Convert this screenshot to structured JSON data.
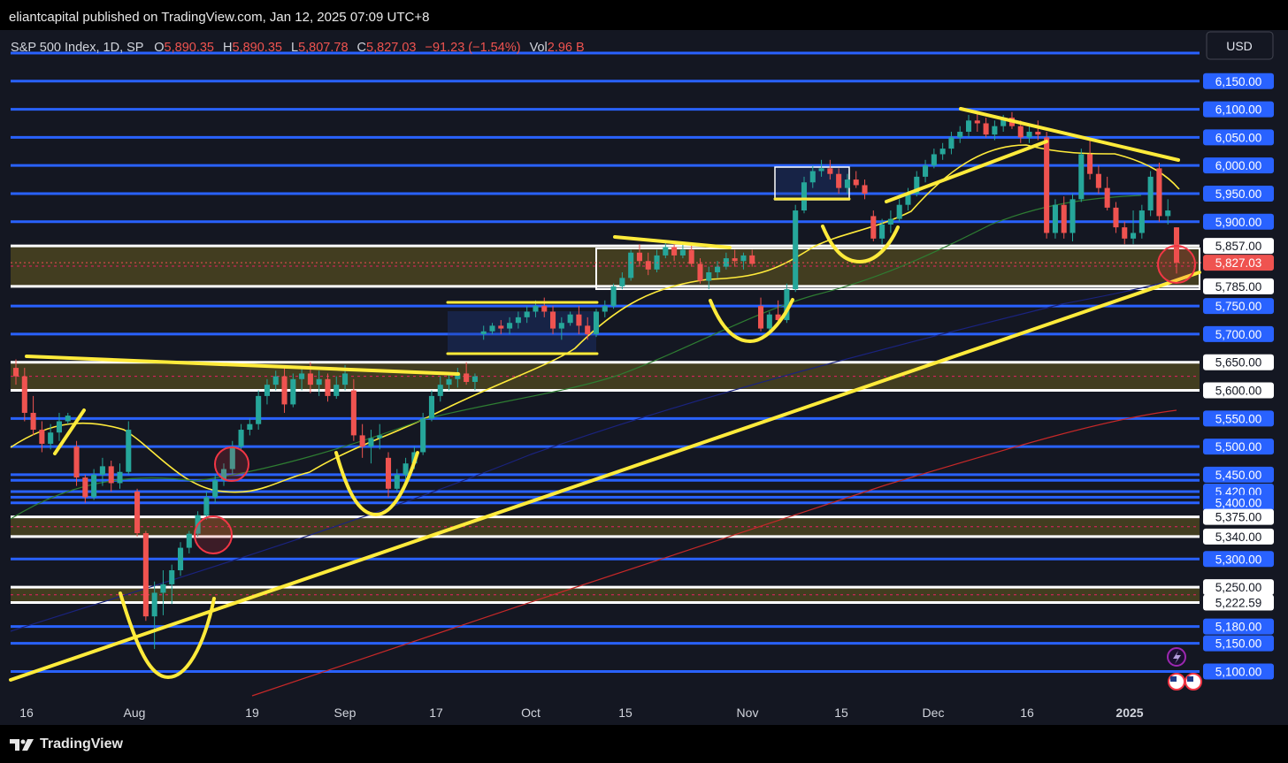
{
  "header": {
    "published_by": "eliantcapital published on TradingView.com, Jan 12, 2025 07:09 UTC+8"
  },
  "legend": {
    "symbol": "S&P 500 Index, 1D, SP",
    "open_label": "O",
    "open": "5,890.35",
    "high_label": "H",
    "high": "5,890.35",
    "low_label": "L",
    "low": "5,807.78",
    "close_label": "C",
    "close": "5,827.03",
    "change": "−91.23 (−1.54%)",
    "vol_label": "Vol",
    "vol": "2.96 B"
  },
  "currency_button": "USD",
  "footer": {
    "brand": "TradingView"
  },
  "colors": {
    "background": "#141722",
    "up": "#26a69a",
    "down": "#ef5350",
    "level_line": "#2962ff",
    "zone_border": "#ffffff",
    "zone_fill": "#4a4420",
    "trendline": "#ffeb3b",
    "last_price": "#ef5350",
    "circle": "#f23645"
  },
  "chart_data": {
    "type": "candlestick",
    "title": "S&P 500 Index, 1D, SP",
    "y_range": [
      5085,
      6200
    ],
    "x_ticks": [
      "16",
      "Aug",
      "19",
      "Sep",
      "17",
      "Oct",
      "15",
      "Nov",
      "15",
      "Dec",
      "16",
      "2025"
    ],
    "price_labels": [
      {
        "value": "6,150.00",
        "kind": "level"
      },
      {
        "value": "6,100.00",
        "kind": "level"
      },
      {
        "value": "6,050.00",
        "kind": "level"
      },
      {
        "value": "6,000.00",
        "kind": "level"
      },
      {
        "value": "5,950.00",
        "kind": "level"
      },
      {
        "value": "5,900.00",
        "kind": "level"
      },
      {
        "value": "5,857.00",
        "kind": "zone"
      },
      {
        "value": "5,827.03",
        "kind": "last"
      },
      {
        "value": "5,785.00",
        "kind": "zone"
      },
      {
        "value": "5,750.00",
        "kind": "level"
      },
      {
        "value": "5,700.00",
        "kind": "level"
      },
      {
        "value": "5,650.00",
        "kind": "zone"
      },
      {
        "value": "5,600.00",
        "kind": "zone"
      },
      {
        "value": "5,550.00",
        "kind": "level"
      },
      {
        "value": "5,500.00",
        "kind": "level"
      },
      {
        "value": "5,450.00",
        "kind": "level"
      },
      {
        "value": "5,420.00",
        "kind": "level"
      },
      {
        "value": "5,400.00",
        "kind": "level"
      },
      {
        "value": "5,375.00",
        "kind": "zone"
      },
      {
        "value": "5,340.00",
        "kind": "zone"
      },
      {
        "value": "5,300.00",
        "kind": "level"
      },
      {
        "value": "5,250.00",
        "kind": "zone"
      },
      {
        "value": "5,222.59",
        "kind": "zone"
      },
      {
        "value": "5,180.00",
        "kind": "level"
      },
      {
        "value": "5,150.00",
        "kind": "level"
      },
      {
        "value": "5,100.00",
        "kind": "level"
      }
    ],
    "extra_levels": [
      6200,
      5440,
      5410
    ],
    "zones": [
      [
        5785,
        5857
      ],
      [
        5600,
        5650
      ],
      [
        5340,
        5375
      ],
      [
        5222.59,
        5250
      ]
    ],
    "last_price": 5827.03,
    "candles": [
      [
        5640,
        5655,
        5610,
        5625
      ],
      [
        5625,
        5640,
        5545,
        5560
      ],
      [
        5560,
        5590,
        5520,
        5530
      ],
      [
        5530,
        5545,
        5490,
        5505
      ],
      [
        5505,
        5540,
        5495,
        5525
      ],
      [
        5525,
        5560,
        5510,
        5545
      ],
      [
        5545,
        5560,
        5540,
        5555
      ],
      [
        5500,
        5510,
        5430,
        5445
      ],
      [
        5445,
        5450,
        5400,
        5410
      ],
      [
        5410,
        5460,
        5405,
        5450
      ],
      [
        5450,
        5480,
        5430,
        5465
      ],
      [
        5465,
        5475,
        5420,
        5435
      ],
      [
        5435,
        5470,
        5425,
        5455
      ],
      [
        5455,
        5545,
        5450,
        5530
      ],
      [
        5420,
        5425,
        5340,
        5346
      ],
      [
        5346,
        5350,
        5190,
        5198
      ],
      [
        5198,
        5260,
        5140,
        5240
      ],
      [
        5240,
        5280,
        5200,
        5255
      ],
      [
        5255,
        5290,
        5220,
        5280
      ],
      [
        5280,
        5330,
        5270,
        5320
      ],
      [
        5320,
        5350,
        5310,
        5345
      ],
      [
        5345,
        5385,
        5340,
        5378
      ],
      [
        5378,
        5420,
        5370,
        5410
      ],
      [
        5410,
        5450,
        5400,
        5440
      ],
      [
        5440,
        5470,
        5430,
        5460
      ],
      [
        5460,
        5510,
        5450,
        5500
      ],
      [
        5500,
        5540,
        5495,
        5530
      ],
      [
        5530,
        5550,
        5520,
        5540
      ],
      [
        5540,
        5600,
        5530,
        5590
      ],
      [
        5590,
        5620,
        5575,
        5610
      ],
      [
        5610,
        5635,
        5600,
        5625
      ],
      [
        5625,
        5640,
        5560,
        5575
      ],
      [
        5575,
        5630,
        5570,
        5620
      ],
      [
        5620,
        5640,
        5600,
        5630
      ],
      [
        5630,
        5650,
        5595,
        5610
      ],
      [
        5610,
        5635,
        5590,
        5620
      ],
      [
        5620,
        5630,
        5580,
        5590
      ],
      [
        5590,
        5625,
        5585,
        5610
      ],
      [
        5610,
        5645,
        5600,
        5630
      ],
      [
        5600,
        5620,
        5510,
        5520
      ],
      [
        5520,
        5540,
        5480,
        5500
      ],
      [
        5500,
        5530,
        5470,
        5515
      ],
      [
        5515,
        5540,
        5495,
        5520
      ],
      [
        5480,
        5490,
        5410,
        5425
      ],
      [
        5425,
        5460,
        5420,
        5450
      ],
      [
        5450,
        5480,
        5440,
        5470
      ],
      [
        5470,
        5500,
        5460,
        5490
      ],
      [
        5490,
        5560,
        5485,
        5550
      ],
      [
        5550,
        5600,
        5545,
        5590
      ],
      [
        5590,
        5625,
        5580,
        5610
      ],
      [
        5610,
        5630,
        5600,
        5620
      ],
      [
        5620,
        5640,
        5605,
        5630
      ],
      [
        5630,
        5650,
        5610,
        5615
      ],
      [
        5615,
        5630,
        5600,
        5625
      ],
      [
        5700,
        5715,
        5690,
        5705
      ],
      [
        5705,
        5720,
        5700,
        5715
      ],
      [
        5715,
        5725,
        5700,
        5710
      ],
      [
        5710,
        5730,
        5700,
        5720
      ],
      [
        5720,
        5740,
        5710,
        5730
      ],
      [
        5730,
        5750,
        5720,
        5740
      ],
      [
        5740,
        5760,
        5730,
        5750
      ],
      [
        5750,
        5765,
        5730,
        5740
      ],
      [
        5740,
        5750,
        5700,
        5710
      ],
      [
        5710,
        5730,
        5690,
        5720
      ],
      [
        5720,
        5740,
        5715,
        5735
      ],
      [
        5735,
        5750,
        5700,
        5715
      ],
      [
        5715,
        5730,
        5690,
        5700
      ],
      [
        5700,
        5745,
        5695,
        5740
      ],
      [
        5740,
        5760,
        5730,
        5750
      ],
      [
        5750,
        5790,
        5745,
        5785
      ],
      [
        5785,
        5810,
        5780,
        5800
      ],
      [
        5800,
        5850,
        5795,
        5845
      ],
      [
        5845,
        5860,
        5820,
        5830
      ],
      [
        5830,
        5845,
        5805,
        5815
      ],
      [
        5815,
        5850,
        5810,
        5840
      ],
      [
        5840,
        5865,
        5835,
        5855
      ],
      [
        5855,
        5865,
        5830,
        5840
      ],
      [
        5840,
        5860,
        5835,
        5850
      ],
      [
        5850,
        5860,
        5820,
        5825
      ],
      [
        5825,
        5835,
        5790,
        5795
      ],
      [
        5795,
        5820,
        5780,
        5810
      ],
      [
        5810,
        5830,
        5800,
        5820
      ],
      [
        5820,
        5845,
        5815,
        5835
      ],
      [
        5835,
        5850,
        5820,
        5830
      ],
      [
        5830,
        5845,
        5815,
        5840
      ],
      [
        5840,
        5850,
        5820,
        5825
      ],
      [
        5750,
        5765,
        5705,
        5710
      ],
      [
        5710,
        5740,
        5700,
        5735
      ],
      [
        5735,
        5760,
        5720,
        5725
      ],
      [
        5725,
        5790,
        5720,
        5780
      ],
      [
        5780,
        5930,
        5775,
        5920
      ],
      [
        5920,
        5980,
        5915,
        5970
      ],
      [
        5970,
        6000,
        5960,
        5990
      ],
      [
        5990,
        6010,
        5980,
        5995
      ],
      [
        5995,
        6010,
        5975,
        5985
      ],
      [
        5985,
        5995,
        5950,
        5960
      ],
      [
        5960,
        5985,
        5950,
        5975
      ],
      [
        5975,
        5990,
        5960,
        5965
      ],
      [
        5965,
        5975,
        5940,
        5950
      ],
      [
        5910,
        5920,
        5865,
        5870
      ],
      [
        5870,
        5905,
        5860,
        5895
      ],
      [
        5895,
        5920,
        5880,
        5905
      ],
      [
        5905,
        5940,
        5900,
        5930
      ],
      [
        5930,
        5960,
        5920,
        5950
      ],
      [
        5950,
        5990,
        5945,
        5980
      ],
      [
        5980,
        6010,
        5970,
        6000
      ],
      [
        6000,
        6030,
        5995,
        6020
      ],
      [
        6020,
        6040,
        6010,
        6030
      ],
      [
        6030,
        6060,
        6020,
        6050
      ],
      [
        6050,
        6070,
        6040,
        6060
      ],
      [
        6060,
        6090,
        6050,
        6080
      ],
      [
        6080,
        6095,
        6060,
        6075
      ],
      [
        6075,
        6085,
        6050,
        6055
      ],
      [
        6055,
        6080,
        6045,
        6070
      ],
      [
        6070,
        6090,
        6060,
        6085
      ],
      [
        6085,
        6095,
        6065,
        6070
      ],
      [
        6070,
        6080,
        6040,
        6050
      ],
      [
        6050,
        6075,
        6040,
        6060
      ],
      [
        6060,
        6080,
        6045,
        6055
      ],
      [
        6050,
        6060,
        5870,
        5880
      ],
      [
        5880,
        5940,
        5870,
        5930
      ],
      [
        5930,
        5945,
        5870,
        5880
      ],
      [
        5880,
        5950,
        5865,
        5940
      ],
      [
        5940,
        6030,
        5935,
        6020
      ],
      [
        6020,
        6045,
        5975,
        5985
      ],
      [
        5985,
        6000,
        5950,
        5960
      ],
      [
        5960,
        5980,
        5920,
        5925
      ],
      [
        5925,
        5935,
        5880,
        5890
      ],
      [
        5890,
        5900,
        5860,
        5870
      ],
      [
        5870,
        5920,
        5860,
        5880
      ],
      [
        5880,
        5930,
        5870,
        5920
      ],
      [
        5920,
        5990,
        5910,
        5980
      ],
      [
        5995,
        6005,
        5900,
        5910
      ],
      [
        5910,
        5940,
        5895,
        5920
      ],
      [
        5890,
        5890,
        5807.78,
        5827.03
      ]
    ]
  }
}
